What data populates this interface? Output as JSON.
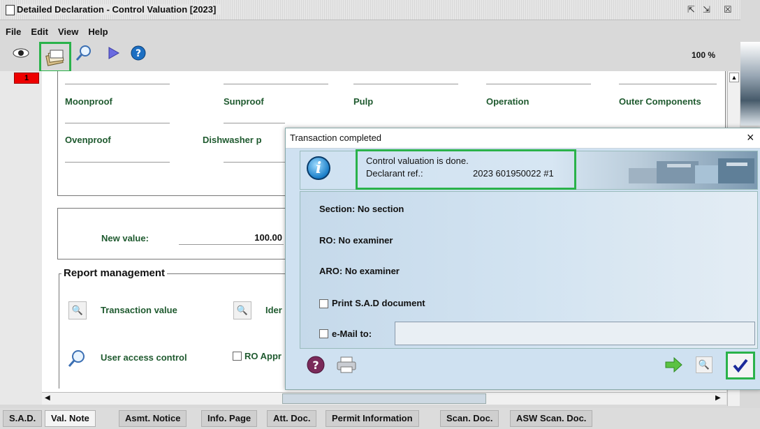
{
  "window": {
    "title": "Detailed Declaration - Control Valuation [2023]"
  },
  "menu": [
    "File",
    "Edit",
    "View",
    "Help"
  ],
  "toolbar": {
    "zoom": "100 %"
  },
  "page_tab": "1",
  "fields": {
    "row1": [
      "Moonproof",
      "Sunproof",
      "Pulp",
      "Operation",
      "Outer Components"
    ],
    "row2": [
      "Ovenproof",
      "Dishwasher p"
    ]
  },
  "new_value": {
    "label": "New value:",
    "value": "100.00"
  },
  "report": {
    "title": "Report management",
    "items": [
      "Transaction value",
      "Ider",
      "User access control",
      "RO Appr"
    ]
  },
  "bottom_tabs": [
    "S.A.D.",
    "Val. Note",
    "Asmt. Notice",
    "Info. Page",
    "Att. Doc.",
    "Permit Information",
    "Scan. Doc.",
    "ASW Scan. Doc."
  ],
  "bottom_tabs_active": "Val. Note",
  "dialog": {
    "title": "Transaction completed",
    "message": "Control valuation is done.",
    "declarant_label": "Declarant ref.:",
    "declarant_value": "2023 601950022 #1",
    "section": "Section: No section",
    "ro": "RO: No examiner",
    "aro": "ARO: No examiner",
    "print_label": "Print S.A.D document",
    "email_label": "e-Mail to:",
    "email_value": ""
  },
  "colors": {
    "highlight": "#2ab24a",
    "page_tab": "#ee0000",
    "dialog_bg": "#cfe1f1"
  }
}
